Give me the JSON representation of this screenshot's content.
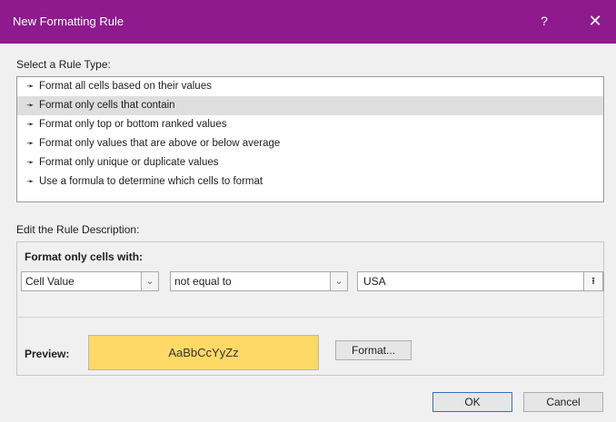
{
  "dialog": {
    "title": "New Formatting Rule",
    "help_label": "?",
    "close_label": "✕"
  },
  "rule_type": {
    "label": "Select a Rule Type:",
    "items": [
      "Format all cells based on their values",
      "Format only cells that contain",
      "Format only top or bottom ranked values",
      "Format only values that are above or below average",
      "Format only unique or duplicate values",
      "Use a formula to determine which cells to format"
    ],
    "selected_index": 1,
    "bullet": "➛"
  },
  "description": {
    "label": "Edit the Rule Description:",
    "format_label": "Format only cells with:",
    "operand": "Cell Value",
    "operator": "not equal to",
    "value": "USA",
    "preview_label": "Preview:",
    "preview_text": "AaBbCcYyZz",
    "preview_color": "#ffd966",
    "format_button": "Format..."
  },
  "buttons": {
    "ok": "OK",
    "cancel": "Cancel"
  }
}
